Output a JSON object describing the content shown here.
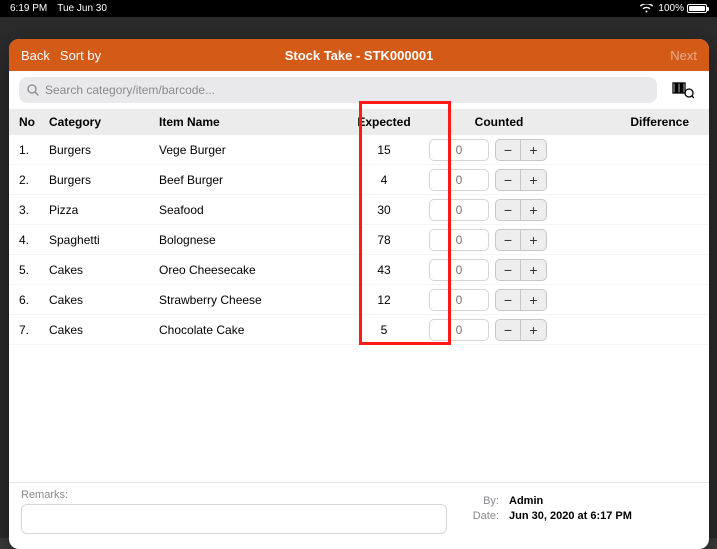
{
  "status_bar": {
    "time": "6:19 PM",
    "date": "Tue Jun 30",
    "battery_pct": "100%"
  },
  "nav": {
    "back": "Back",
    "sort": "Sort by",
    "title": "Stock Take - STK000001",
    "next": "Next"
  },
  "search": {
    "placeholder": "Search category/item/barcode..."
  },
  "columns": {
    "no": "No",
    "category": "Category",
    "item_name": "Item Name",
    "expected": "Expected",
    "counted": "Counted",
    "difference": "Difference"
  },
  "counted_placeholder": "0",
  "rows": [
    {
      "no": "1.",
      "category": "Burgers",
      "item": "Vege Burger",
      "expected": "15"
    },
    {
      "no": "2.",
      "category": "Burgers",
      "item": "Beef Burger",
      "expected": "4"
    },
    {
      "no": "3.",
      "category": "Pizza",
      "item": "Seafood",
      "expected": "30"
    },
    {
      "no": "4.",
      "category": "Spaghetti",
      "item": "Bolognese",
      "expected": "78"
    },
    {
      "no": "5.",
      "category": "Cakes",
      "item": "Oreo Cheesecake",
      "expected": "43"
    },
    {
      "no": "6.",
      "category": "Cakes",
      "item": "Strawberry Cheese",
      "expected": "12"
    },
    {
      "no": "7.",
      "category": "Cakes",
      "item": "Chocolate Cake",
      "expected": "5"
    }
  ],
  "footer": {
    "remarks_label": "Remarks:",
    "by_label": "By:",
    "by_value": "Admin",
    "date_label": "Date:",
    "date_value": "Jun 30, 2020 at 6:17 PM"
  }
}
